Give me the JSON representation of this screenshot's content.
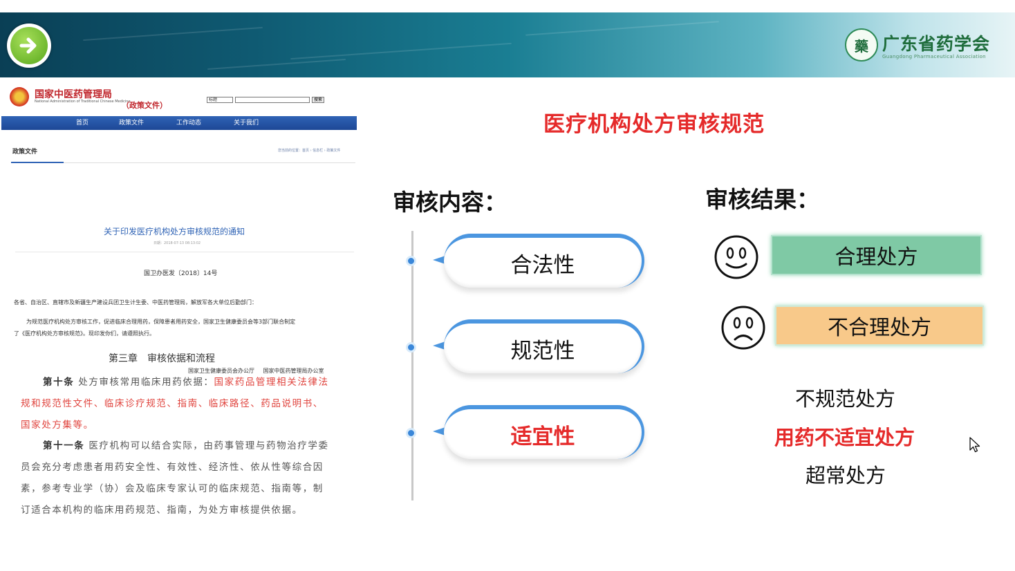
{
  "brand": {
    "seal_glyph": "藥",
    "name": "广东省药学会",
    "subtitle": "Guangdong Pharmaceutical Association"
  },
  "document": {
    "org_name": "国家中医药管理局",
    "org_name_en": "National Administration of Traditional Chinese Medicine",
    "policy_tag": "（政策文件）",
    "search": {
      "select_value": "标题",
      "button_label": "搜索"
    },
    "nav": [
      "首页",
      "政策文件",
      "工作动态",
      "关于我们"
    ],
    "panel_heading": "政策文件",
    "breadcrumb": "您当前的位置：首页 › 信息栏 › 政策文件",
    "notice_title": "关于印发医疗机构处方审核规范的通知",
    "notice_date": "日期：2018-07-13 08:13:02",
    "doc_number": "国卫办医发〔2018〕14号",
    "addressee": "各省、自治区、直辖市及新疆生产建设兵团卫生计生委、中医药管理局，解放军各大单位后勤部门：",
    "body_line1": "为规范医疗机构处方审核工作，促进临床合理用药，保障患者用药安全，国家卫生健康委员会等3部门联合制定",
    "body_line2": "了《医疗机构处方审核规范》。现印发你们，请遵照执行。",
    "signer1": "国家卫生健康委员会办公厅",
    "signer2": "国家中医药管理局办公室",
    "chapter": "第三章　审核依据和流程",
    "article10_lead": "第十条",
    "article10_text": "处方审核常用临床用药依据：",
    "article10_red": "国家药品管理相关法律法规和规范性文件、临床诊疗规范、指南、临床路径、药品说明书、国家处方集等。",
    "article11_lead": "第十一条",
    "article11_text": "医疗机构可以结合实际，由药事管理与药物治疗学委员会充分考虑患者用药安全性、有效性、经济性、依从性等综合因素，参考专业学（协）会及临床专家认可的临床规范、指南等，制订适合本机构的临床用药规范、指南，为处方审核提供依据。"
  },
  "slide": {
    "title": "医疗机构处方审核规范",
    "content_heading": "审核内容：",
    "result_heading": "审核结果：",
    "content_items": [
      "合法性",
      "规范性",
      "适宜性"
    ],
    "result_reasonable": "合理处方",
    "result_unreasonable": "不合理处方",
    "sub_items": [
      "不规范处方",
      "用药不适宜处方",
      "超常处方"
    ]
  },
  "colors": {
    "accent_red": "#e52a2a",
    "timeline_blue": "#4b96e0",
    "green_box": "#7fc9a5",
    "orange_box": "#f8c98a",
    "brand_green": "#1f6d3c"
  },
  "icons": {
    "next": "arrow-right-icon",
    "happy": "smiley-face-icon",
    "sad": "frown-face-icon",
    "cursor": "mouse-pointer-icon"
  }
}
